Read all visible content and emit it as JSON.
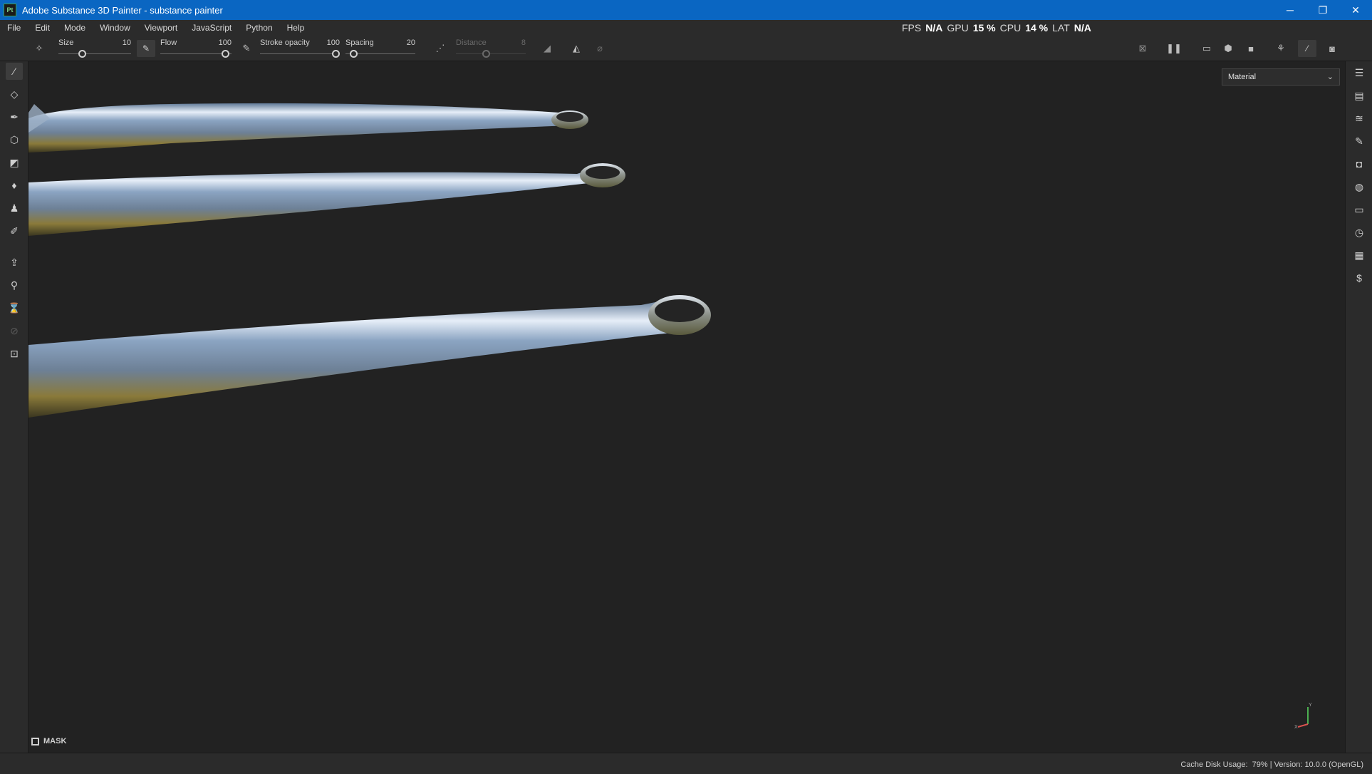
{
  "window": {
    "app_icon": "Pt",
    "title": "Adobe Substance 3D Painter - substance painter",
    "controls": [
      "minimize-icon",
      "restore-icon",
      "close-icon"
    ]
  },
  "menu": [
    "File",
    "Edit",
    "Mode",
    "Window",
    "Viewport",
    "JavaScript",
    "Python",
    "Help"
  ],
  "perf": {
    "fps_label": "FPS",
    "fps_value": "N/A",
    "gpu_label": "GPU",
    "gpu_value": "15 %",
    "cpu_label": "CPU",
    "cpu_value": "14 %",
    "lat_label": "LAT",
    "lat_value": "N/A"
  },
  "tool_options": {
    "size": {
      "label": "Size",
      "value": "10"
    },
    "flow": {
      "label": "Flow",
      "value": "100"
    },
    "stroke_opacity": {
      "label": "Stroke opacity",
      "value": "100"
    },
    "spacing": {
      "label": "Spacing",
      "value": "20"
    },
    "distance": {
      "label": "Distance",
      "value": "8"
    }
  },
  "viewport": {
    "material_select": "Material",
    "mask_label": "MASK",
    "gizmo_axes": [
      "Y",
      "X"
    ]
  },
  "status": {
    "cache_label": "Cache Disk Usage:",
    "cache_value": "79%",
    "separator": "|",
    "version": "Version: 10.0.0 (OpenGL)"
  },
  "colors": {
    "titlebar": "#0a66c2",
    "panel": "#2b2b2b",
    "viewport": "#222222",
    "metal_highlight": "#c7d6ea",
    "metal_shadow": "#8a7a3a"
  }
}
